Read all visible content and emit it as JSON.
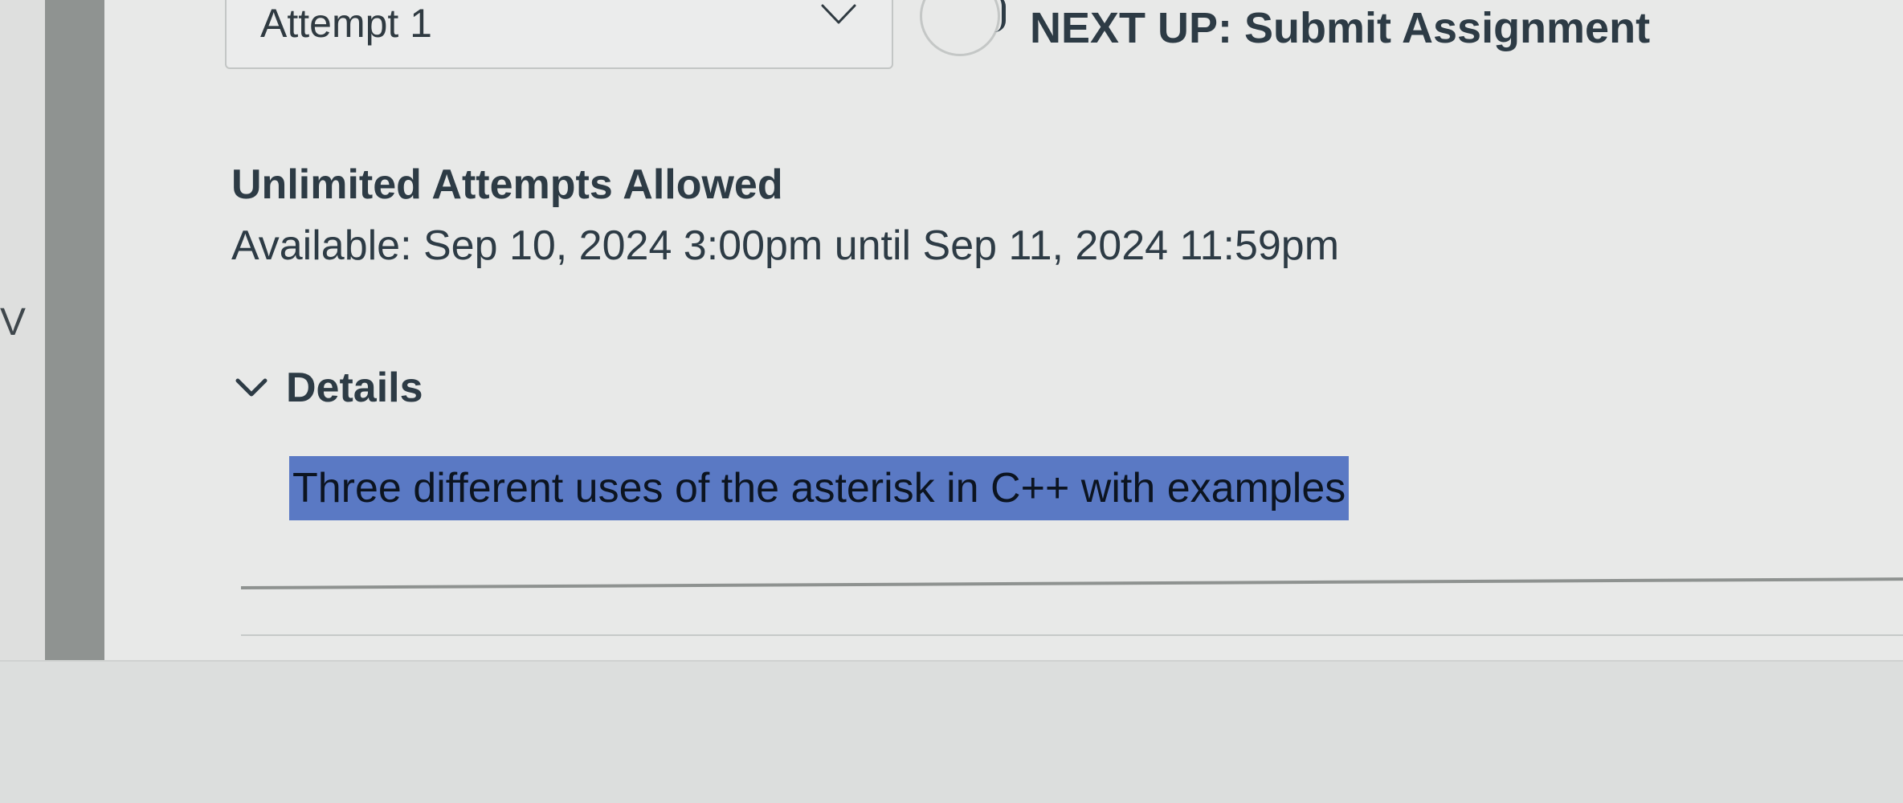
{
  "attempt_select": {
    "value": "Attempt 1"
  },
  "next_up": {
    "text": "NEXT UP: Submit Assignment"
  },
  "attempts": {
    "label": "Unlimited Attempts Allowed"
  },
  "availability": {
    "text": "Available: Sep 10, 2024 3:00pm until Sep 11, 2024 11:59pm"
  },
  "details": {
    "toggle_label": "Details",
    "expanded": true,
    "description": "Three different uses of the asterisk in C++ with examples",
    "highlight_color": "#5a79c4"
  },
  "sidebar": {
    "caret_glyph": "V"
  },
  "colors": {
    "text_primary": "#2d3b45",
    "sidebar_bar": "#8f9391",
    "background": "#e8e9e8"
  },
  "icons": {
    "select_chevron": "chevron-down-icon",
    "details_chevron": "chevron-down-icon",
    "progress_circle": "progress-ring-icon"
  }
}
